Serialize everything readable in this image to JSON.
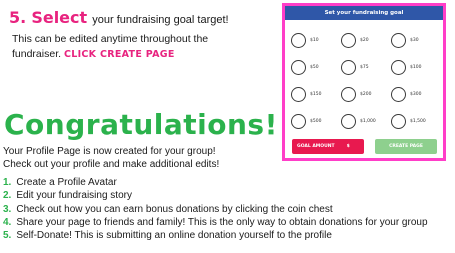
{
  "step": {
    "number": "5.",
    "keyword": "Select",
    "rest": "your fundraising goal target!"
  },
  "description": {
    "text": "This can be edited anytime throughout the fundraiser.",
    "cta": "CLICK CREATE PAGE"
  },
  "mock": {
    "title": "Set your fundraising goal",
    "amounts": [
      "$10",
      "$20",
      "$30",
      "$50",
      "$75",
      "$100",
      "$150",
      "$200",
      "$300",
      "$500",
      "$1,000",
      "$1,500"
    ],
    "goal_label": "GOAL AMOUNT",
    "currency_symbol": "$",
    "create_label": "CREATE PAGE"
  },
  "congrats": "Congratulations!",
  "intro": [
    "Your Profile Page is now created for your group!",
    "Check out your profile and make additional edits!"
  ],
  "todo": [
    {
      "n": "1.",
      "text": "Create a Profile Avatar"
    },
    {
      "n": "2.",
      "text": "Edit your fundraising story"
    },
    {
      "n": "3.",
      "text": "Check out how you can earn bonus donations by clicking the coin chest"
    },
    {
      "n": "4.",
      "text": "Share your page to friends and family! This is the only way to obtain donations for your group"
    },
    {
      "n": "5.",
      "text": "Self-Donate! This is submitting an online donation yourself to the profile"
    }
  ],
  "colors": {
    "accent_pink": "#e8237f",
    "accent_green": "#2bb24c",
    "mock_header": "#2f57a8",
    "mock_border": "#ff3ec8",
    "goal_button": "#e8194f",
    "create_button": "#8ed08e"
  }
}
